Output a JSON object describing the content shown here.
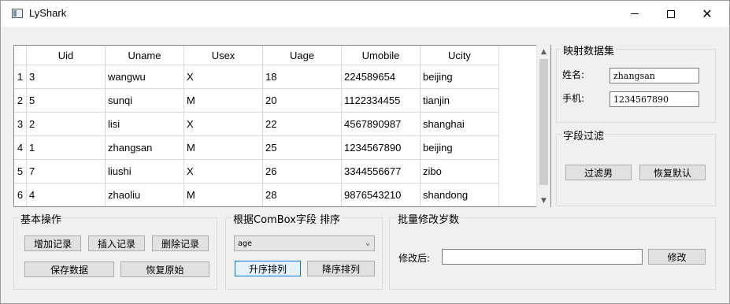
{
  "window": {
    "title": "LyShark"
  },
  "table": {
    "headers": [
      "Uid",
      "Uname",
      "Usex",
      "Uage",
      "Umobile",
      "Ucity"
    ],
    "rows": [
      {
        "num": "1",
        "cells": [
          "3",
          "wangwu",
          "X",
          "18",
          "224589654",
          "beijing"
        ]
      },
      {
        "num": "2",
        "cells": [
          "5",
          "sunqi",
          "M",
          "20",
          "1122334455",
          "tianjin"
        ]
      },
      {
        "num": "3",
        "cells": [
          "2",
          "lisi",
          "X",
          "22",
          "4567890987",
          "shanghai"
        ]
      },
      {
        "num": "4",
        "cells": [
          "1",
          "zhangsan",
          "M",
          "25",
          "1234567890",
          "beijing"
        ]
      },
      {
        "num": "5",
        "cells": [
          "7",
          "liushi",
          "X",
          "26",
          "3344556677",
          "zibo"
        ]
      },
      {
        "num": "6",
        "cells": [
          "4",
          "zhaoliu",
          "M",
          "28",
          "9876543210",
          "shandong"
        ]
      }
    ]
  },
  "mapping": {
    "title": "映射数据集",
    "name_label": "姓名:",
    "name_value": "zhangsan",
    "phone_label": "手机:",
    "phone_value": "1234567890"
  },
  "filter": {
    "title": "字段过滤",
    "filter_male": "过滤男",
    "restore_default": "恢复默认"
  },
  "basic": {
    "title": "基本操作",
    "add": "增加记录",
    "insert": "插入记录",
    "delete": "删除记录",
    "save": "保存数据",
    "restore": "恢复原始"
  },
  "sort": {
    "title": "根据ComBox字段 排序",
    "selected": "age",
    "asc": "升序排列",
    "desc": "降序排列"
  },
  "batch": {
    "title": "批量修改岁数",
    "label": "修改后:",
    "value": "",
    "modify": "修改"
  }
}
